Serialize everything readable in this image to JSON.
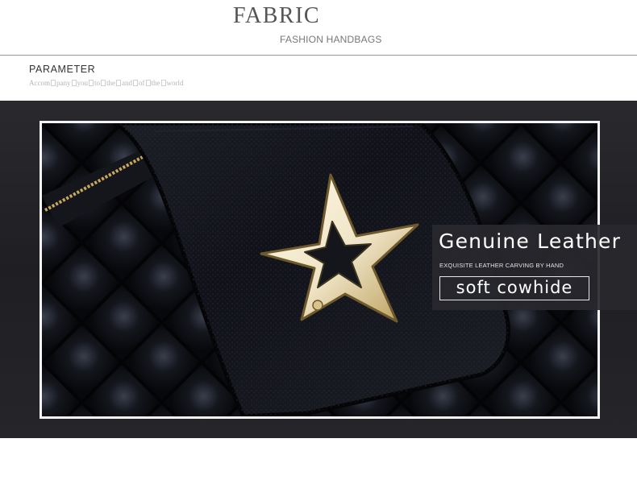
{
  "header": {
    "title": "FABRIC",
    "subtitle": "FASHION HANDBAGS"
  },
  "parameter": {
    "title": "PARAMETER",
    "tagline_words": [
      "Accom",
      "pany",
      "you",
      "to",
      "the",
      "and",
      "of",
      "the",
      "world"
    ]
  },
  "feature": {
    "title": "Genuine Leather",
    "subtitle": "EXQUISITE LEATHER CARVING BY HAND",
    "badge": "soft cowhide"
  },
  "colors": {
    "band": "#222226",
    "leather": "#0c0d12",
    "star": "#f3ecd8",
    "zipper": "#c8a95a"
  },
  "icons": {
    "hardware": "star-clasp-icon"
  }
}
